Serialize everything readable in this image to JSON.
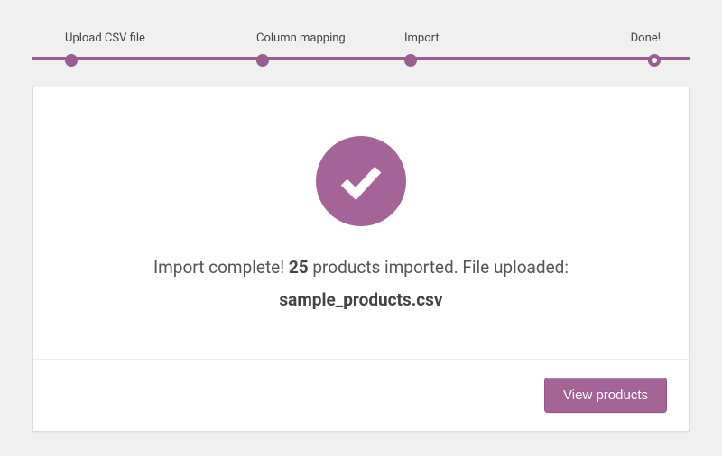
{
  "stepper": {
    "steps": [
      {
        "label": "Upload CSV file",
        "state": "done"
      },
      {
        "label": "Column mapping",
        "state": "done"
      },
      {
        "label": "Import",
        "state": "done"
      },
      {
        "label": "Done!",
        "state": "current"
      }
    ]
  },
  "result": {
    "message_prefix": "Import complete! ",
    "count": "25",
    "message_mid": " products imported. File uploaded:",
    "filename": "sample_products.csv"
  },
  "actions": {
    "view_products_label": "View products"
  },
  "colors": {
    "accent": "#9b5c8f",
    "accent_light": "#a46497"
  }
}
